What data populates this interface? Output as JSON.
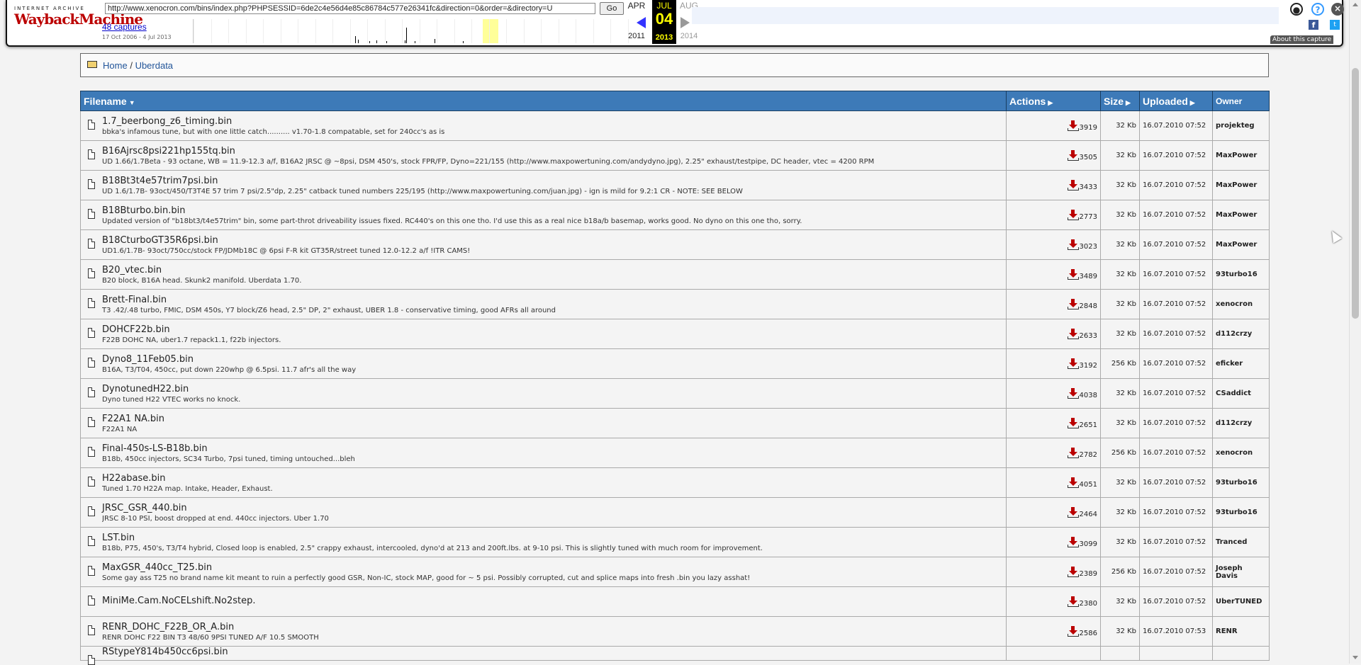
{
  "wayback": {
    "logo_top": "INTERNET ARCHIVE",
    "logo_main": "WaybackMachine",
    "url": "http://www.xenocron.com/bins/index.php?PHPSESSID=6de2c4e56d4e85c86784c577e26341fc&direction=0&order=&directory=U",
    "go_label": "Go",
    "captures": "48 captures",
    "date_range": "17 Oct 2006 - 4 Jul 2013",
    "prev_month": "APR",
    "prev_year": "2011",
    "cur_month": "JUL",
    "cur_day": "04",
    "cur_year": "2013",
    "next_month": "AUG",
    "next_year": "2014",
    "about": "About this capture",
    "fb": "f",
    "tw": "t"
  },
  "breadcrumb": {
    "home": "Home",
    "sep": "/",
    "current": "Uberdata"
  },
  "table": {
    "headers": {
      "filename": "Filename",
      "actions": "Actions",
      "size": "Size",
      "uploaded": "Uploaded",
      "owner": "Owner"
    },
    "rows": [
      {
        "name": "1.7_beerbong_z6_timing.bin",
        "desc": "bbka's infamous tune, but with one little catch.......... v1.70-1.8 compatable, set for 240cc's as is",
        "downloads": "3919",
        "size": "32 Kb",
        "uploaded": "16.07.2010 07:52",
        "owner": "projekteg"
      },
      {
        "name": "B16Ajrsc8psi221hp155tq.bin",
        "desc": "UD 1.66/1.7Beta - 93 octane, WB = 11.9-12.3 a/f, B16A2 JRSC @ ~8psi, DSM 450's, stock FPR/FP, Dyno=221/155 (http://www.maxpowertuning.com/andydyno.jpg), 2.25\" exhaust/testpipe, DC header, vtec = 4200 RPM",
        "downloads": "3505",
        "size": "32 Kb",
        "uploaded": "16.07.2010 07:52",
        "owner": "MaxPower"
      },
      {
        "name": "B18Bt3t4e57trim7psi.bin",
        "desc": "UD 1.6/1.7B- 93oct/450/T3T4E 57 trim 7 psi/2.5\"dp, 2.25\" catback tuned numbers 225/195 (http://www.maxpowertuning.com/juan.jpg) - ign is mild for 9.2:1 CR - NOTE: SEE BELOW",
        "downloads": "3433",
        "size": "32 Kb",
        "uploaded": "16.07.2010 07:52",
        "owner": "MaxPower"
      },
      {
        "name": "B18Bturbo.bin.bin",
        "desc": "Updated version of \"b18bt3/t4e57trim\" bin, some part-throt driveability issues fixed. RC440's on this one tho. I'd use this as a real nice b18a/b basemap, works good. No dyno on this one tho, sorry.",
        "downloads": "2773",
        "size": "32 Kb",
        "uploaded": "16.07.2010 07:52",
        "owner": "MaxPower"
      },
      {
        "name": "B18CturboGT35R6psi.bin",
        "desc": "UD1.6/1.7B- 93oct/750cc/stock FP/JDMb18C @ 6psi F-R kit GT35R/street tuned 12.0-12.2 a/f !ITR CAMS!",
        "downloads": "3023",
        "size": "32 Kb",
        "uploaded": "16.07.2010 07:52",
        "owner": "MaxPower"
      },
      {
        "name": "B20_vtec.bin",
        "desc": "B20 block, B16A head. Skunk2 manifold. Uberdata 1.70.",
        "downloads": "3489",
        "size": "32 Kb",
        "uploaded": "16.07.2010 07:52",
        "owner": "93turbo16"
      },
      {
        "name": "Brett-Final.bin",
        "desc": "T3 .42/.48 turbo, FMIC, DSM 450s, Y7 block/Z6 head, 2.5\" DP, 2\" exhaust, UBER 1.8 - conservative timing, good AFRs all around",
        "downloads": "2848",
        "size": "32 Kb",
        "uploaded": "16.07.2010 07:52",
        "owner": "xenocron"
      },
      {
        "name": "DOHCF22b.bin",
        "desc": "F22B DOHC NA, uber1.7 repack1.1, f22b injectors.",
        "downloads": "2633",
        "size": "32 Kb",
        "uploaded": "16.07.2010 07:52",
        "owner": "d112crzy"
      },
      {
        "name": "Dyno8_11Feb05.bin",
        "desc": "B16A, T3/T04, 450cc, put down 220whp @ 6.5psi. 11.7 afr's all the way",
        "downloads": "3192",
        "size": "256 Kb",
        "uploaded": "16.07.2010 07:52",
        "owner": "eficker"
      },
      {
        "name": "DynotunedH22.bin",
        "desc": "Dyno tuned H22 VTEC works no knock.",
        "downloads": "4038",
        "size": "32 Kb",
        "uploaded": "16.07.2010 07:52",
        "owner": "CSaddict"
      },
      {
        "name": "F22A1 NA.bin",
        "desc": "F22A1 NA",
        "downloads": "2651",
        "size": "32 Kb",
        "uploaded": "16.07.2010 07:52",
        "owner": "d112crzy"
      },
      {
        "name": "Final-450s-LS-B18b.bin",
        "desc": "B18b, 450cc injectors, SC34 Turbo, 7psi tuned, timing untouched...bleh",
        "downloads": "2782",
        "size": "256 Kb",
        "uploaded": "16.07.2010 07:52",
        "owner": "xenocron"
      },
      {
        "name": "H22abase.bin",
        "desc": "Tuned 1.70 H22A map. Intake, Header, Exhaust.",
        "downloads": "4051",
        "size": "32 Kb",
        "uploaded": "16.07.2010 07:52",
        "owner": "93turbo16"
      },
      {
        "name": "JRSC_GSR_440.bin",
        "desc": "JRSC 8-10 PSI, boost dropped at end. 440cc injectors. Uber 1.70",
        "downloads": "2464",
        "size": "32 Kb",
        "uploaded": "16.07.2010 07:52",
        "owner": "93turbo16"
      },
      {
        "name": "LST.bin",
        "desc": "B18b, P75, 450's, T3/T4 hybrid, Closed loop is enabled, 2.5\" crappy exhaust, intercooled, dyno'd at 213 and 200ft.lbs. at 9-10 psi. This is slightly tuned with much room for improvement.",
        "downloads": "3099",
        "size": "32 Kb",
        "uploaded": "16.07.2010 07:52",
        "owner": "Tranced"
      },
      {
        "name": "MaxGSR_440cc_T25.bin",
        "desc": "Some gay ass T25 no brand name kit meant to ruin a perfectly good GSR, Non-IC, stock MAP, good for ~ 5 psi. Possibly corrupted, cut and splice maps into fresh .bin you lazy asshat!",
        "downloads": "2389",
        "size": "256 Kb",
        "uploaded": "16.07.2010 07:52",
        "owner": "Joseph Davis"
      },
      {
        "name": "MiniMe.Cam.NoCELshift.No2step.",
        "desc": "",
        "downloads": "2380",
        "size": "32 Kb",
        "uploaded": "16.07.2010 07:52",
        "owner": "UberTUNED"
      },
      {
        "name": "RENR_DOHC_F22B_OR_A.bin",
        "desc": "RENR DOHC F22 BIN T3 48/60 9PSI TUNED A/F 10.5 SMOOTH",
        "downloads": "2586",
        "size": "32 Kb",
        "uploaded": "16.07.2010 07:53",
        "owner": "RENR"
      },
      {
        "name": "RStypeY814b450cc6psi.bin",
        "desc": "",
        "downloads": "",
        "size": "",
        "uploaded": "",
        "owner": ""
      }
    ]
  }
}
